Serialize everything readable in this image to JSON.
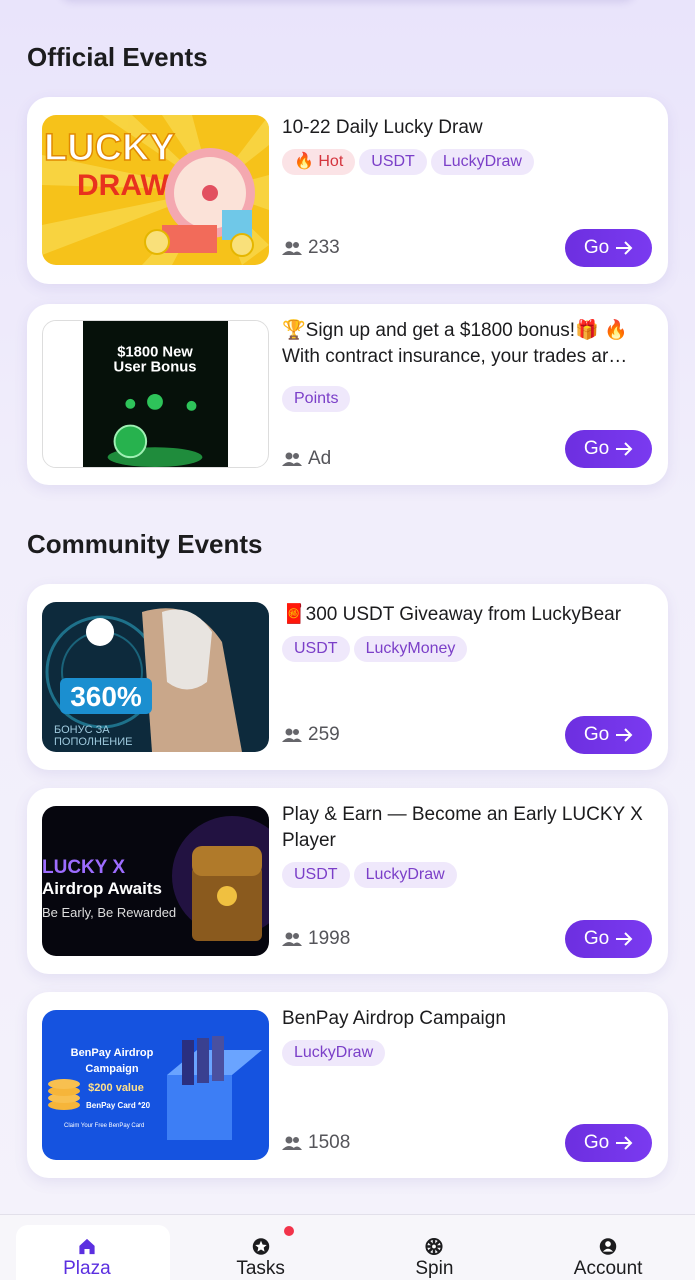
{
  "sections": {
    "official_title": "Official Events",
    "community_title": "Community Events"
  },
  "events": [
    {
      "title": "10-22 Daily Lucky Draw",
      "tags": [
        "🔥 Hot",
        "USDT",
        "LuckyDraw"
      ],
      "participants": "233",
      "go_label": "Go",
      "thumb_text": [
        "LUCKY",
        "DRAW!"
      ]
    },
    {
      "title": "🏆Sign up and get a $1800 bonus!🎁 🔥 With contract insurance, your trades ar…",
      "tags": [
        "Points"
      ],
      "participants": "Ad",
      "go_label": "Go",
      "thumb_text": [
        "$1800 New",
        "User Bonus"
      ]
    },
    {
      "title": "🧧300 USDT Giveaway from LuckyBear",
      "tags": [
        "USDT",
        "LuckyMoney"
      ],
      "participants": "259",
      "go_label": "Go",
      "thumb_text": [
        "360%",
        "БОНУС ЗА",
        "ПОПОЛНЕНИЕ"
      ]
    },
    {
      "title": "Play & Earn — Become an Early LUCKY X Player",
      "tags": [
        "USDT",
        "LuckyDraw"
      ],
      "participants": "1998",
      "go_label": "Go",
      "thumb_text": [
        "LUCKY X",
        "Airdrop Awaits",
        "Be Early, Be Rewarded"
      ]
    },
    {
      "title": "BenPay Airdrop Campaign",
      "tags": [
        "LuckyDraw"
      ],
      "participants": "1508",
      "go_label": "Go",
      "thumb_text": [
        "BenPay Airdrop",
        "Campaign",
        "$200 value",
        "BenPay Card *20",
        "Claim Your Free BenPay Card"
      ]
    }
  ],
  "nav": [
    {
      "label": "Plaza",
      "icon": "home-icon",
      "active": true
    },
    {
      "label": "Tasks",
      "icon": "star-badge-icon",
      "badge": true
    },
    {
      "label": "Spin",
      "icon": "wheel-icon"
    },
    {
      "label": "Account",
      "icon": "user-circle-icon"
    }
  ],
  "colors": {
    "accent": "#6d2fe0",
    "tag_bg": "#efe8fb",
    "tag_text": "#7b3fc8",
    "hot_bg": "#fbe3e6",
    "hot_text": "#d4343d",
    "badge": "#f2334a"
  }
}
